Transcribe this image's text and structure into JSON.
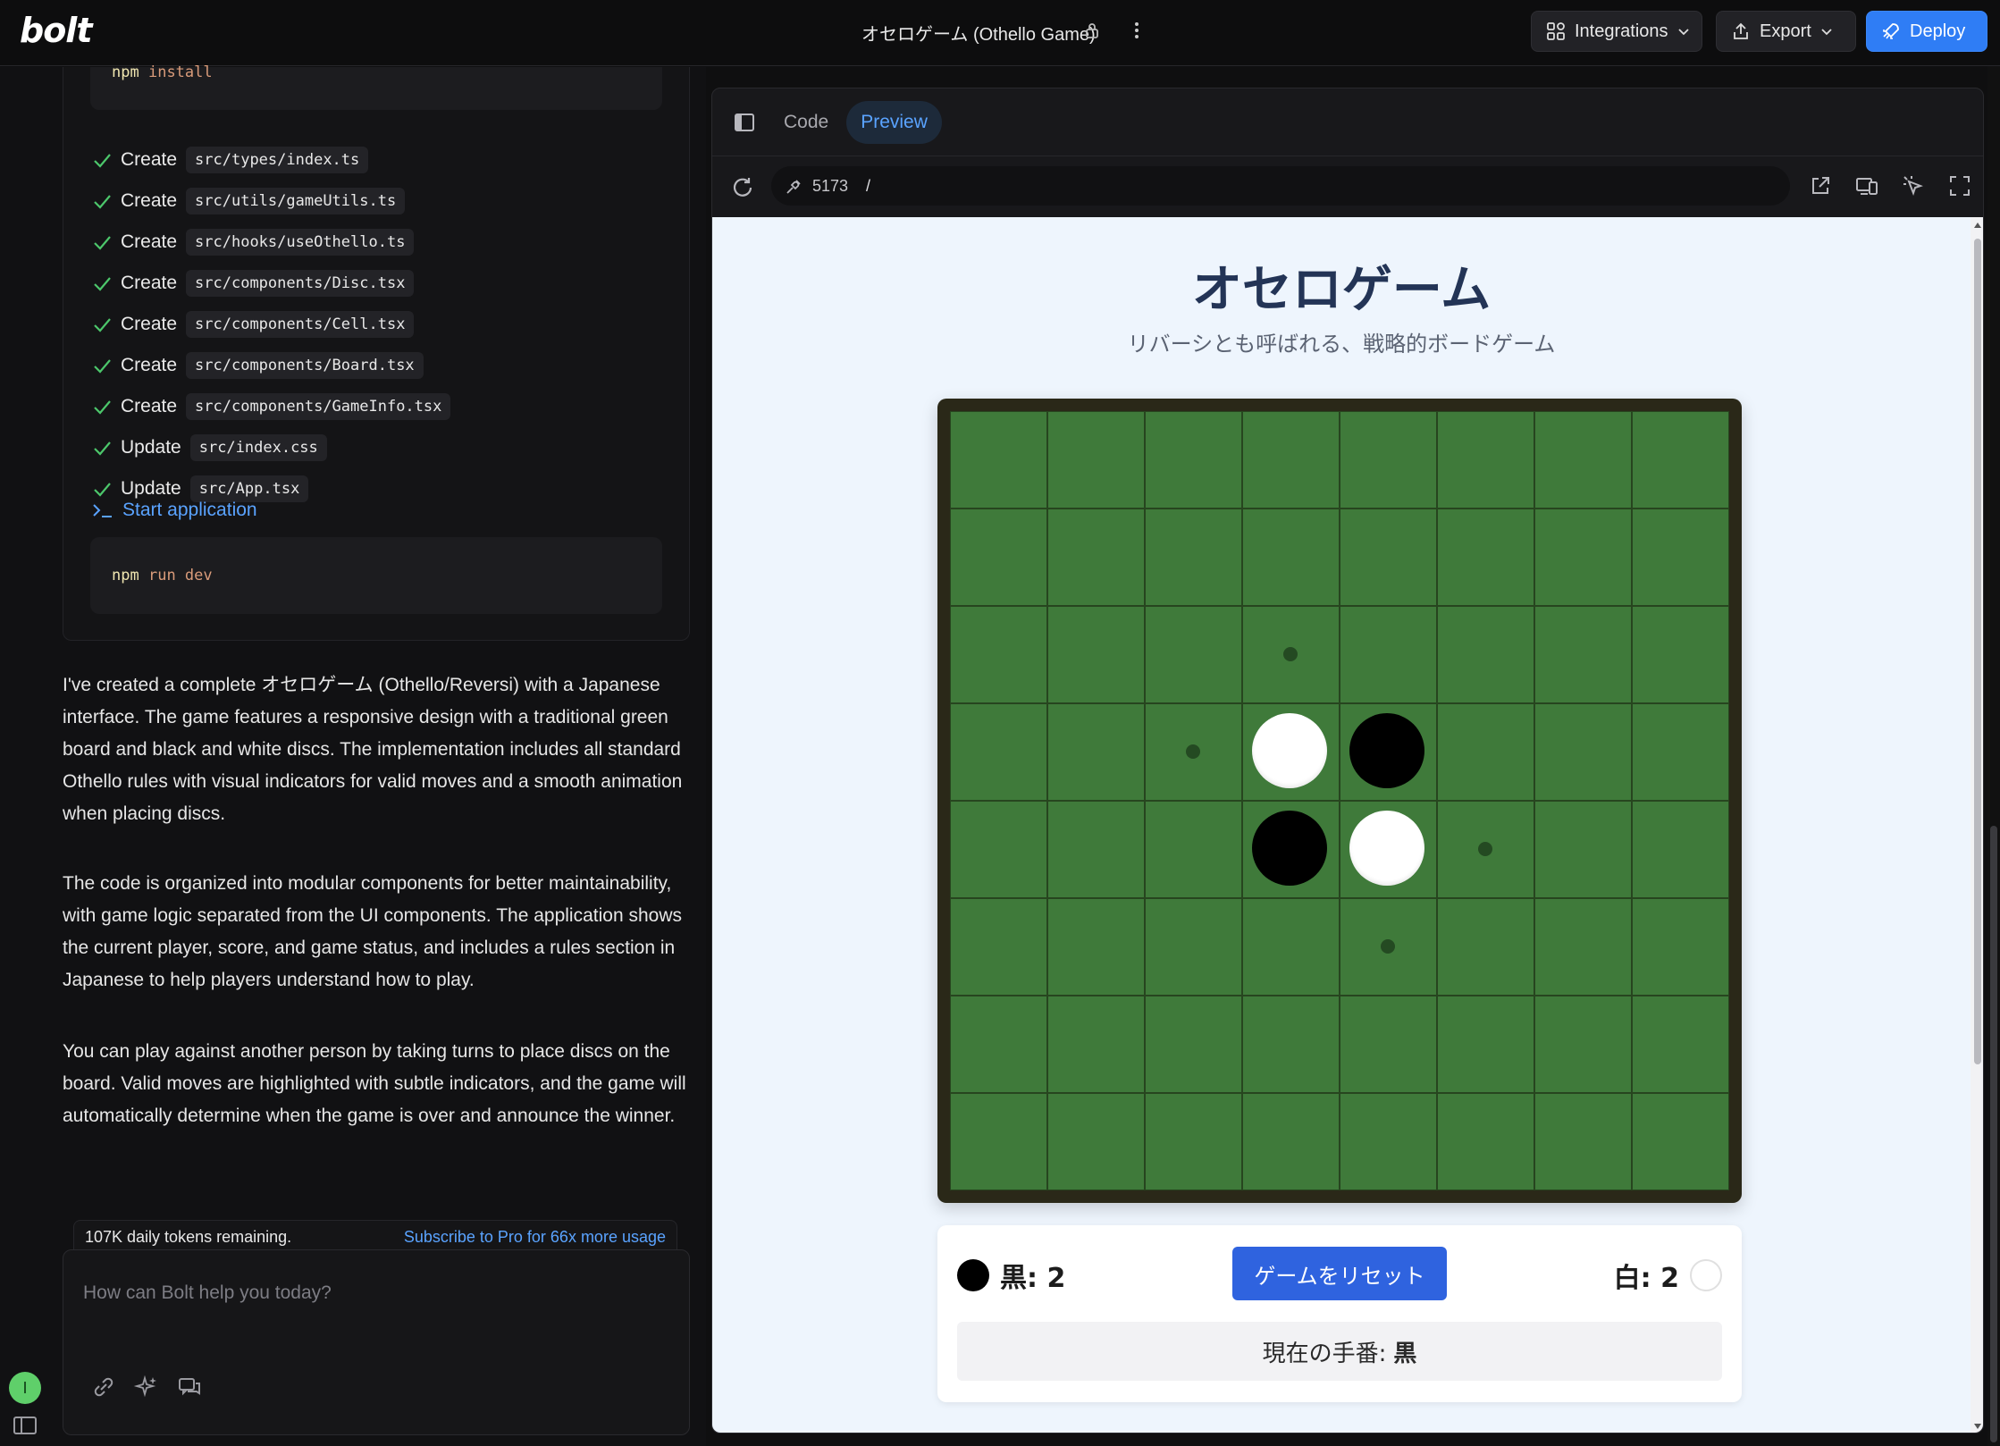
{
  "header": {
    "logo": "bolt",
    "project_title": "オセロゲーム (Othello Game)",
    "integrations_label": "Integrations",
    "export_label": "Export",
    "deploy_label": "Deploy"
  },
  "chat": {
    "install_cmd_bin": "npm",
    "install_cmd_arg": "install",
    "steps": [
      {
        "action": "Create",
        "path": "src/types/index.ts"
      },
      {
        "action": "Create",
        "path": "src/utils/gameUtils.ts"
      },
      {
        "action": "Create",
        "path": "src/hooks/useOthello.ts"
      },
      {
        "action": "Create",
        "path": "src/components/Disc.tsx"
      },
      {
        "action": "Create",
        "path": "src/components/Cell.tsx"
      },
      {
        "action": "Create",
        "path": "src/components/Board.tsx"
      },
      {
        "action": "Create",
        "path": "src/components/GameInfo.tsx"
      },
      {
        "action": "Update",
        "path": "src/index.css"
      },
      {
        "action": "Update",
        "path": "src/App.tsx"
      }
    ],
    "start_app_label": "Start application",
    "run_cmd_bin": "npm",
    "run_cmd_arg": "run dev",
    "paragraphs": [
      "I've created a complete オセロゲーム (Othello/Reversi) with a Japanese interface. The game features a responsive design with a traditional green board and black and white discs. The implementation includes all standard Othello rules with visual indicators for valid moves and a smooth animation when placing discs.",
      "The code is organized into modular components for better maintainability, with game logic separated from the UI components. The application shows the current player, score, and game status, and includes a rules section in Japanese to help players understand how to play.",
      "You can play against another person by taking turns to place discs on the board. Valid moves are highlighted with subtle indicators, and the game will automatically determine when the game is over and announce the winner."
    ],
    "tokens_remaining": "107K daily tokens remaining.",
    "subscribe_label": "Subscribe to Pro for 66x more usage",
    "prompt_placeholder": "How can Bolt help you today?",
    "avatar_initial": "I"
  },
  "workbench": {
    "tabs": [
      "Code",
      "Preview"
    ],
    "active_tab": "Preview",
    "port": "5173",
    "path": "/"
  },
  "game": {
    "title": "オセロゲーム",
    "subtitle": "リバーシとも呼ばれる、戦略的ボードゲーム",
    "board": [
      [
        "",
        "",
        "",
        "",
        "",
        "",
        "",
        ""
      ],
      [
        "",
        "",
        "",
        "",
        "",
        "",
        "",
        ""
      ],
      [
        "",
        "",
        "",
        "hint",
        "",
        "",
        "",
        ""
      ],
      [
        "",
        "",
        "hint",
        "W",
        "B",
        "",
        "",
        ""
      ],
      [
        "",
        "",
        "",
        "B",
        "W",
        "hint",
        "",
        ""
      ],
      [
        "",
        "",
        "",
        "",
        "hint",
        "",
        "",
        ""
      ],
      [
        "",
        "",
        "",
        "",
        "",
        "",
        "",
        ""
      ],
      [
        "",
        "",
        "",
        "",
        "",
        "",
        "",
        ""
      ]
    ],
    "black_score_label": "黒: 2",
    "white_score_label": "白: 2",
    "reset_label": "ゲームをリセット",
    "turn_label": "現在の手番:",
    "turn_value": "黒"
  },
  "colors": {
    "deploy": "#2f7df5",
    "link": "#5aa3ff",
    "board_green": "#3f7a3a",
    "reset_button": "#2f63df"
  }
}
